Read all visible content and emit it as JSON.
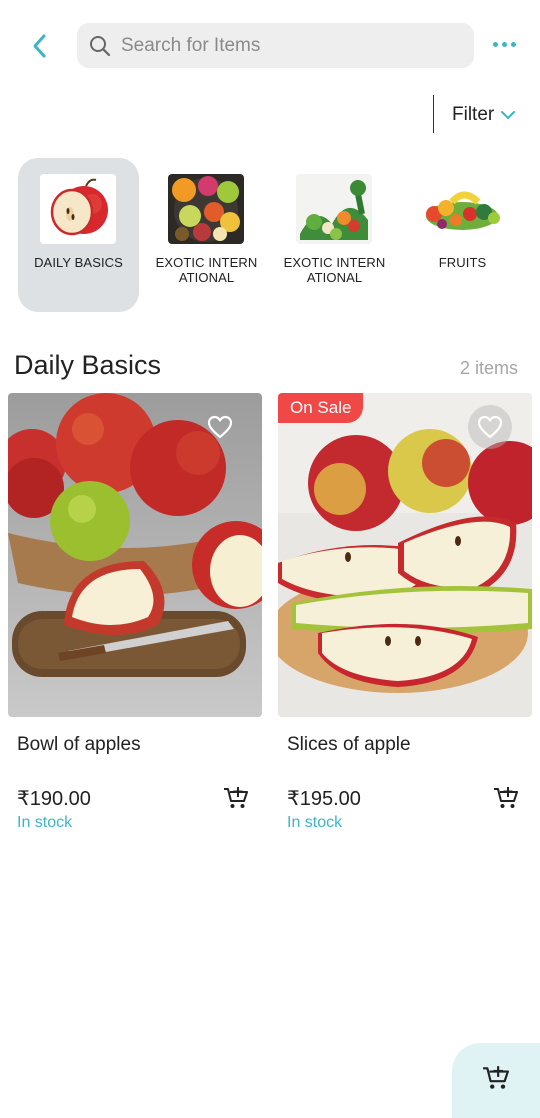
{
  "header": {
    "search_placeholder": "Search for Items"
  },
  "filter": {
    "label": "Filter"
  },
  "categories": [
    {
      "label": "DAILY BASICS",
      "active": true,
      "icon": "apple-image"
    },
    {
      "label": "EXOTIC INTERN ATIONAL",
      "active": false,
      "icon": "exotic-fruit-platter-image"
    },
    {
      "label": "EXOTIC INTERN ATIONAL",
      "active": false,
      "icon": "vegetables-image"
    },
    {
      "label": "FRUITS",
      "active": false,
      "icon": "mixed-fruits-image"
    }
  ],
  "section": {
    "title": "Daily Basics",
    "count": "2 items"
  },
  "products": [
    {
      "name": "Bowl of apples",
      "price": "₹190.00",
      "stock": "In stock",
      "badge": "",
      "image": "bowl-of-apples-image"
    },
    {
      "name": "Slices of apple",
      "price": "₹195.00",
      "stock": "In stock",
      "badge": "On Sale",
      "image": "apple-slices-image"
    }
  ],
  "colors": {
    "accent": "#3cb5c9",
    "sale": "#f04747",
    "active_category_bg": "#dde1e4",
    "fab_bg": "#dff3f5"
  }
}
